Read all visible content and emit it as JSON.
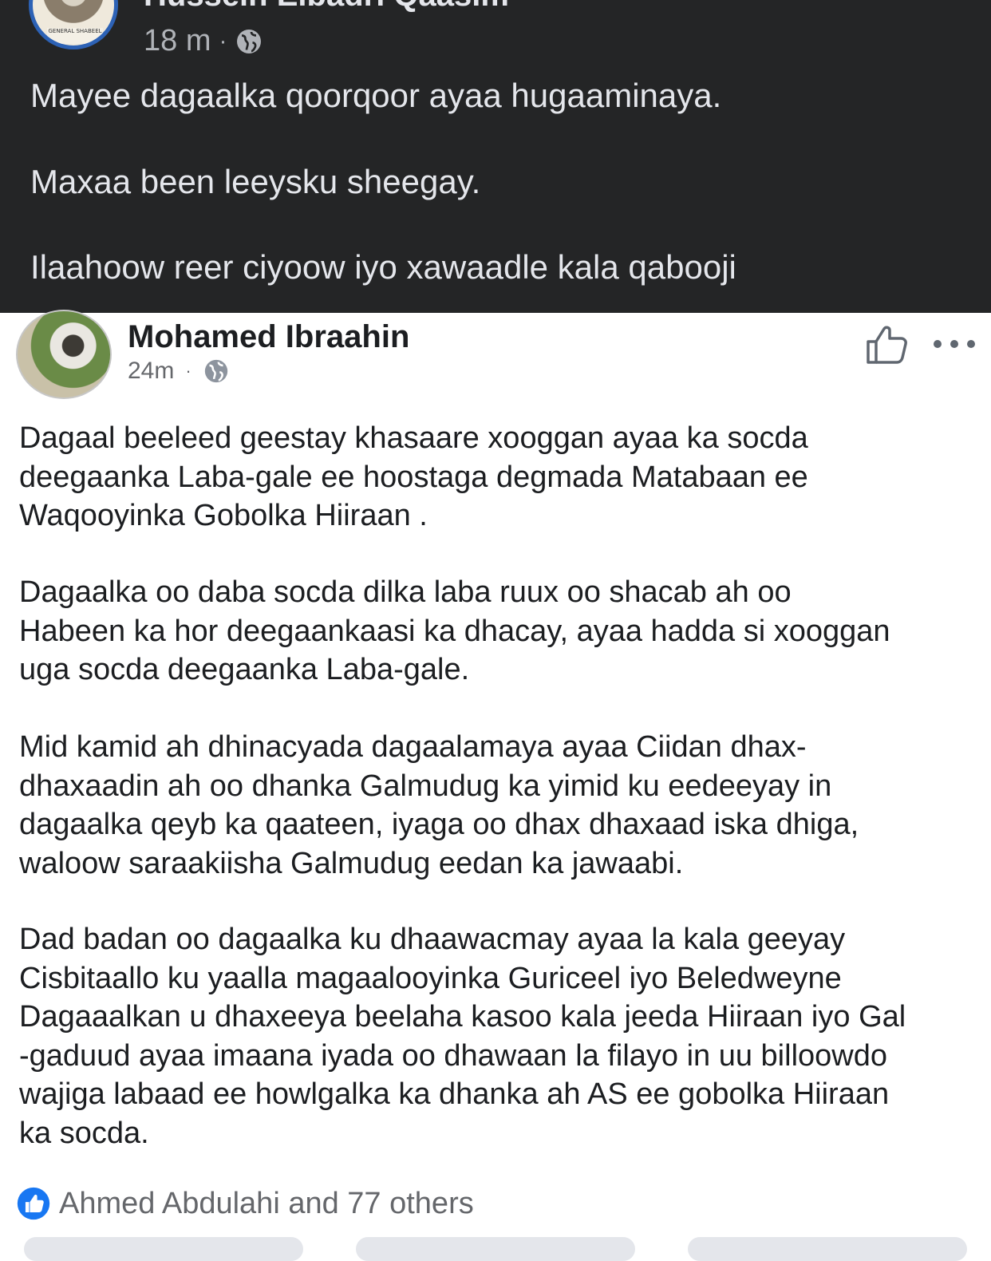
{
  "outer_post": {
    "author_name": "Hussein Elbadri Qaasim",
    "avatar_tag": "GENERAL SHABEEL",
    "time": "18 m",
    "separator": "·",
    "lines": [
      "Mayee dagaalka qoorqoor ayaa hugaaminaya.",
      "Maxaa been leeysku sheegay.",
      "Ilaahoow reer ciyoow iyo xawaadle kala qabooji"
    ]
  },
  "shared_post": {
    "author_name": "Mohamed Ibraahin",
    "time": "24m",
    "separator": "·",
    "paragraphs": [
      [
        "Dagaal  beeleed geestay khasaare xooggan ayaa ka socda",
        "deegaanka  Laba-gale ee hoostaga degmada Matabaan ee",
        "Waqooyinka Gobolka Hiiraan ."
      ],
      [
        "Dagaalka oo daba socda dilka laba ruux oo shacab ah oo",
        "Habeen ka hor deegaankaasi ka dhacay, ayaa hadda si xooggan",
        "uga socda deegaanka Laba-gale."
      ],
      [
        "Mid kamid ah dhinacyada dagaalamaya ayaa Ciidan dhax-",
        "dhaxaadin ah oo dhanka Galmudug ka yimid ku eedeeyay in",
        "dagaalka qeyb ka qaateen, iyaga oo dhax dhaxaad iska dhiga,",
        "waloow saraakiisha Galmudug eedan ka jawaabi."
      ],
      [
        "Dad badan oo dagaalka ku dhaawacmay ayaa la kala geeyay",
        "Cisbitaallo ku yaalla magaalooyinka Guriceel iyo Beledweyne",
        "Dagaaalkan u dhaxeeya beelaha kasoo kala jeeda Hiiraan iyo Gal",
        "-gaduud ayaa imaana iyada oo dhawaan la filayo in uu billoowdo",
        "wajiga labaad ee howlgalka ka dhanka ah AS ee gobolka Hiiraan",
        "ka socda."
      ]
    ],
    "reactions_text": "Ahmed Abdulahi and 77 others"
  },
  "icons": {
    "globe": "globe-icon",
    "like": "thumbs-up-icon",
    "more": "more-options-icon",
    "like_reaction": "like-reaction-icon"
  },
  "colors": {
    "dark_background": "#242526",
    "avatar_ring": "#2d62b5",
    "like_blue": "#1877f2"
  }
}
